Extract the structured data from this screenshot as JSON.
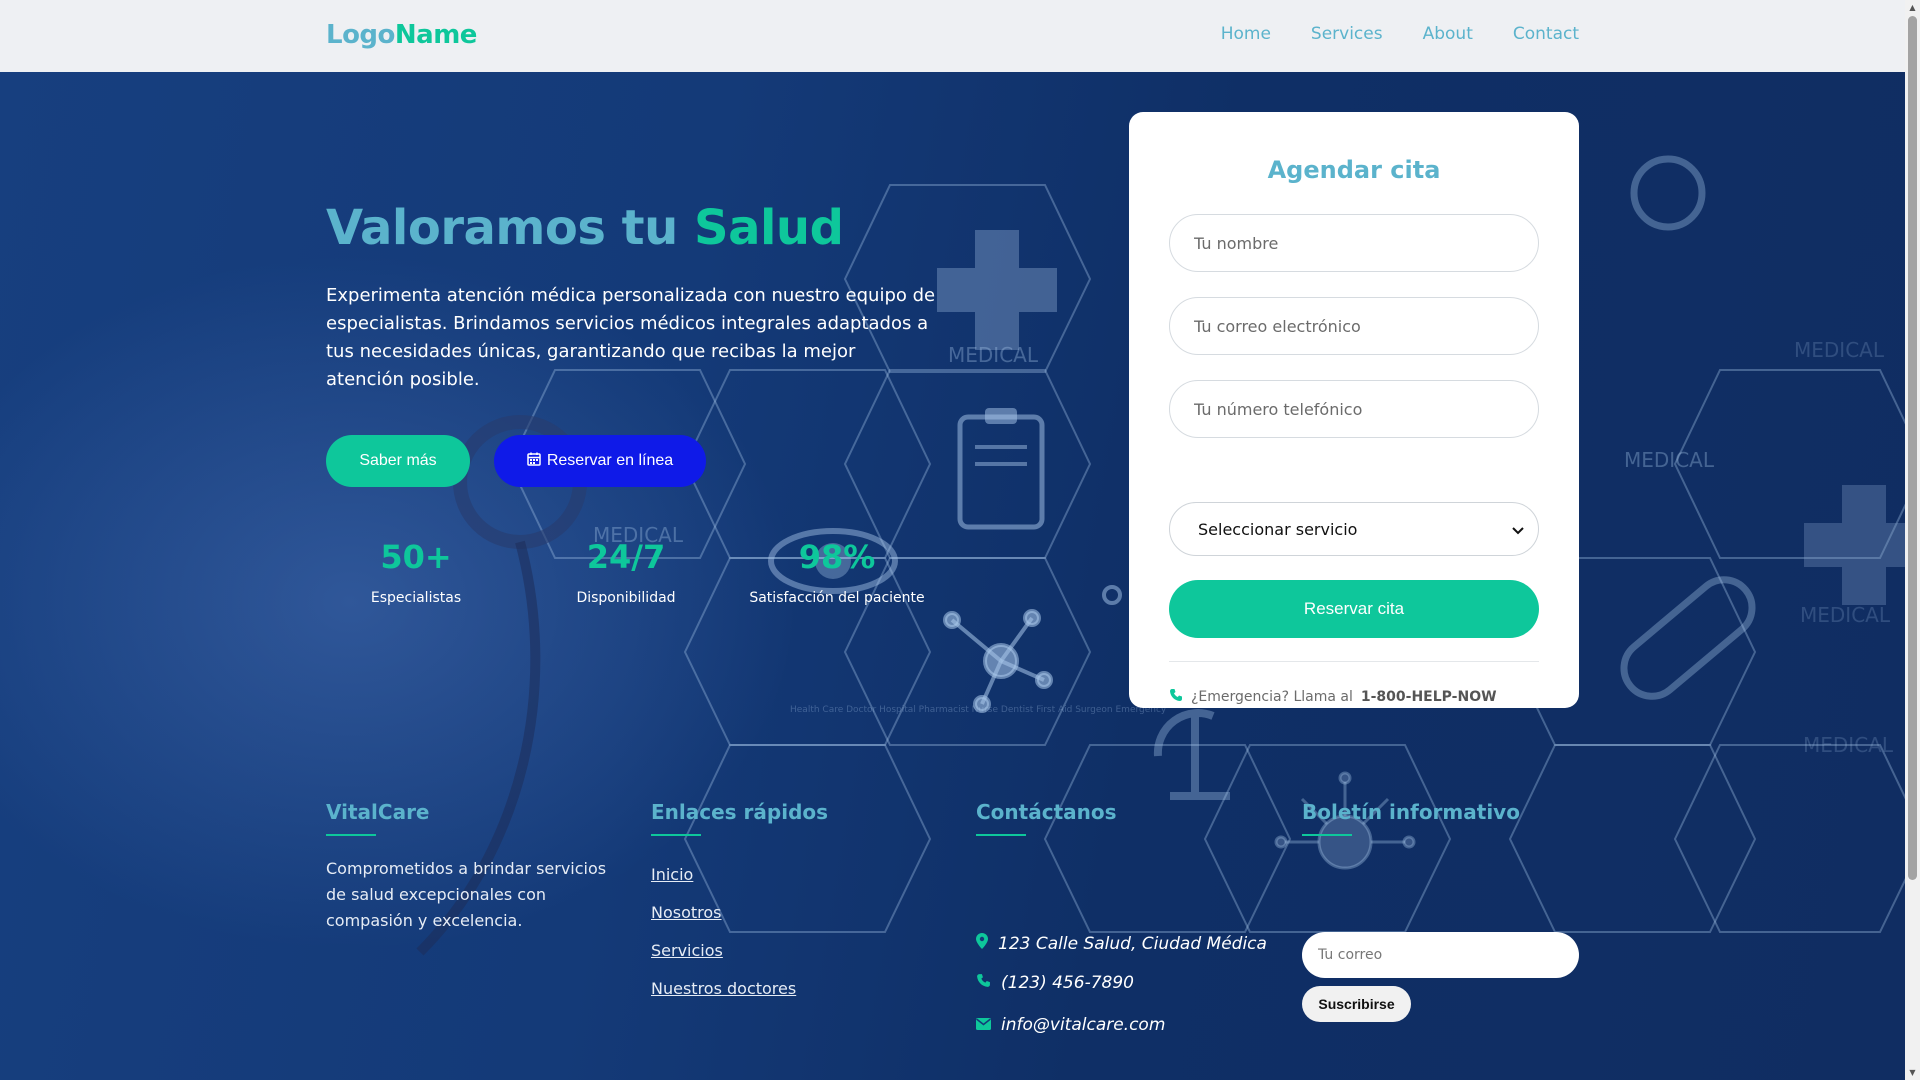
{
  "nav": {
    "logo_part1": "Logo",
    "logo_part2": "Name",
    "links": [
      "Home",
      "Services",
      "About",
      "Contact"
    ]
  },
  "hero": {
    "title_part1": "Valoramos tu",
    "title_part2": "Salud",
    "description": "Experimenta atención médica personalizada con nuestro equipo de especialistas. Brindamos servicios médicos integrales adaptados a tus necesidades únicas, garantizando que recibas la mejor atención posible.",
    "btn_more": "Saber más",
    "btn_book": "Reservar en línea",
    "stats": [
      {
        "value": "50+",
        "label": "Especialistas"
      },
      {
        "value": "24/7",
        "label": "Disponibilidad"
      },
      {
        "value": "98%",
        "label": "Satisfacción del paciente"
      }
    ],
    "background_labels": [
      "MEDICAL",
      "MEDICAL",
      "MEDICAL",
      "MEDICAL",
      "MEDICAL",
      "MEDICAL"
    ],
    "background_list": "Health Care Doctor Hospital Pharmacist Nurse Dentist First Aid Surgeon Emergency"
  },
  "form": {
    "title": "Agendar cita",
    "name_placeholder": "Tu nombre",
    "email_placeholder": "Tu correo electrónico",
    "phone_placeholder": "Tu número telefónico",
    "service_selected": "Seleccionar servicio",
    "submit": "Reservar cita",
    "emergency_text": "¿Emergencia? Llama al",
    "emergency_number": "1-800-HELP-NOW"
  },
  "footer": {
    "about_title": "VitalCare",
    "about_text": "Comprometidos a brindar servicios de salud excepcionales con compasión y excelencia.",
    "links_title": "Enlaces rápidos",
    "links": [
      "Inicio",
      "Nosotros",
      "Servicios",
      "Nuestros doctores"
    ],
    "contact_title": "Contáctanos",
    "address": "123 Calle Salud, Ciudad Médica",
    "phone": "(123) 456-7890",
    "email": "info@vitalcare.com",
    "newsletter_title": "Boletín informativo",
    "newsletter_placeholder": "Tu correo",
    "newsletter_btn": "Suscribirse"
  },
  "colors": {
    "primary_blue": "#5bb3cc",
    "accent_green": "#0ec79b",
    "book_blue": "#0f1ae8",
    "hero_bg": "#143a78"
  }
}
